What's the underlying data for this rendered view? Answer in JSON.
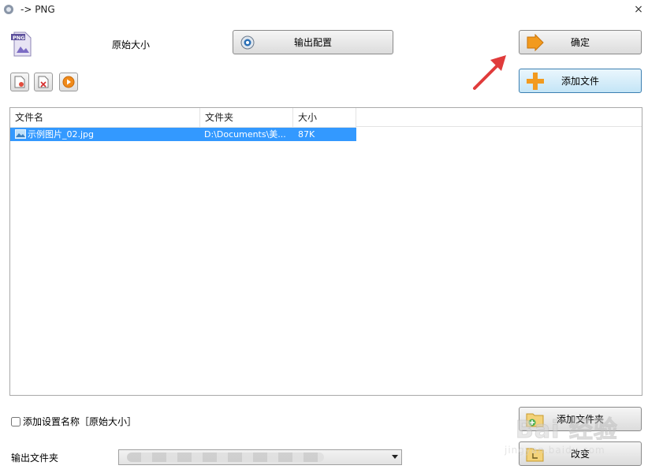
{
  "window": {
    "title": "-> PNG",
    "close_glyph": "×"
  },
  "top": {
    "size_label": "原始大小"
  },
  "buttons": {
    "output_config": "输出配置",
    "ok": "确定",
    "add_file": "添加文件",
    "add_folder": "添加文件夹",
    "change": "改变"
  },
  "file_list": {
    "columns": [
      "文件名",
      "文件夹",
      "大小"
    ],
    "rows": [
      {
        "name": "示例图片_02.jpg",
        "folder": "D:\\Documents\\美...",
        "size": "87K"
      }
    ]
  },
  "bottom": {
    "checkbox_label": "添加设置名称［原始大小］",
    "checkbox_checked": false,
    "output_folder_label": "输出文件夹"
  },
  "watermark": {
    "text": "Bai 经验",
    "sub": "jingyan.baidu.com"
  },
  "colors": {
    "selection": "#3399ff",
    "annotation_arrow": "#e03b3b",
    "accent_orange": "#f29a1e"
  }
}
